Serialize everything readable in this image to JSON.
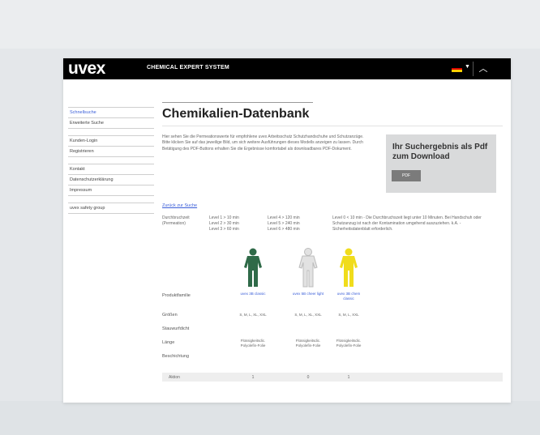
{
  "header": {
    "logo": "uvex",
    "app_title": "CHEMICAL EXPERT SYSTEM",
    "flag_colors": [
      "#000000",
      "#dd0000",
      "#ffce00"
    ],
    "lang_caret": "▼",
    "up_icon": "︿"
  },
  "sidebar": {
    "groups": [
      [
        "Schnellsuche",
        "Erweiterte Suche"
      ],
      [
        "Kunden-Login",
        "Registrieren"
      ],
      [
        "Kontakt",
        "Datenschutzerklärung",
        "Impressum"
      ],
      [
        "uvex safety group"
      ]
    ],
    "active": "Schnellsuche"
  },
  "main": {
    "title": "Chemikalien-Datenbank",
    "intro": "Hier sehen Sie die Permeationswerte für empfohlene uvex Arbeitsschutz Schutzhandschuhe und Schutzanzüge. Bitte klicken Sie auf das jeweilige Bild, um sich weitere Ausführungen dieses Modells anzeigen zu lassen. Durch Betätigung des PDF-Buttons erhalten Sie die Ergebnisse komfortabel als downloadbares PDF-Dokument.",
    "download": {
      "text": "Ihr Suchergebnis als Pdf zum Download",
      "button": "PDF"
    },
    "back_link": "Zurück zur Suche",
    "permeation": {
      "label": "Durchbruchzeit (Permeation)",
      "col1": [
        "Level 1 > 10 min",
        "Level 2 > 30 min",
        "Level 3 > 60 min"
      ],
      "col2": [
        "Level 4 > 120 min",
        "Level 5 > 240 min",
        "Level 6 > 480 min"
      ],
      "note": "Level 0 < 10 min - Die Durchbruchszeit liegt unter 10 Minuten. Bei Handschuh oder Schutzanzug ist nach der Kontamination umgehend auszuziehen. k.A. - Sicherheitsdatenblatt erforderlich."
    },
    "products": {
      "row_label": "Produktfamilie",
      "suits": [
        {
          "name": "uvex 3B classic",
          "color": "#2f6a48"
        },
        {
          "name": "uvex 5B cheer light",
          "color": "#e2e2e2"
        },
        {
          "name": "uvex 3B chem classic",
          "color": "#f0dc1c"
        }
      ]
    },
    "sizes": {
      "label": "Größen",
      "values": [
        "S, M, L, XL, XXL",
        "S, M, L, XL, XXL",
        "S, M, L, XXL"
      ]
    },
    "thickness": {
      "label": "Stauwurfdicht"
    },
    "length": {
      "label": "Länge",
      "values": [
        "Flüssigkeitsdic. Polyolefin-Folie",
        "Flüssigkeitsdic. Polyolefin-Folie",
        "Flüssigkeitsdic. Polyolefin-Folie"
      ]
    },
    "coating": {
      "label": "Beschichtung"
    },
    "action": {
      "label": "Aktion",
      "values": [
        "1",
        "0",
        "1"
      ]
    }
  }
}
